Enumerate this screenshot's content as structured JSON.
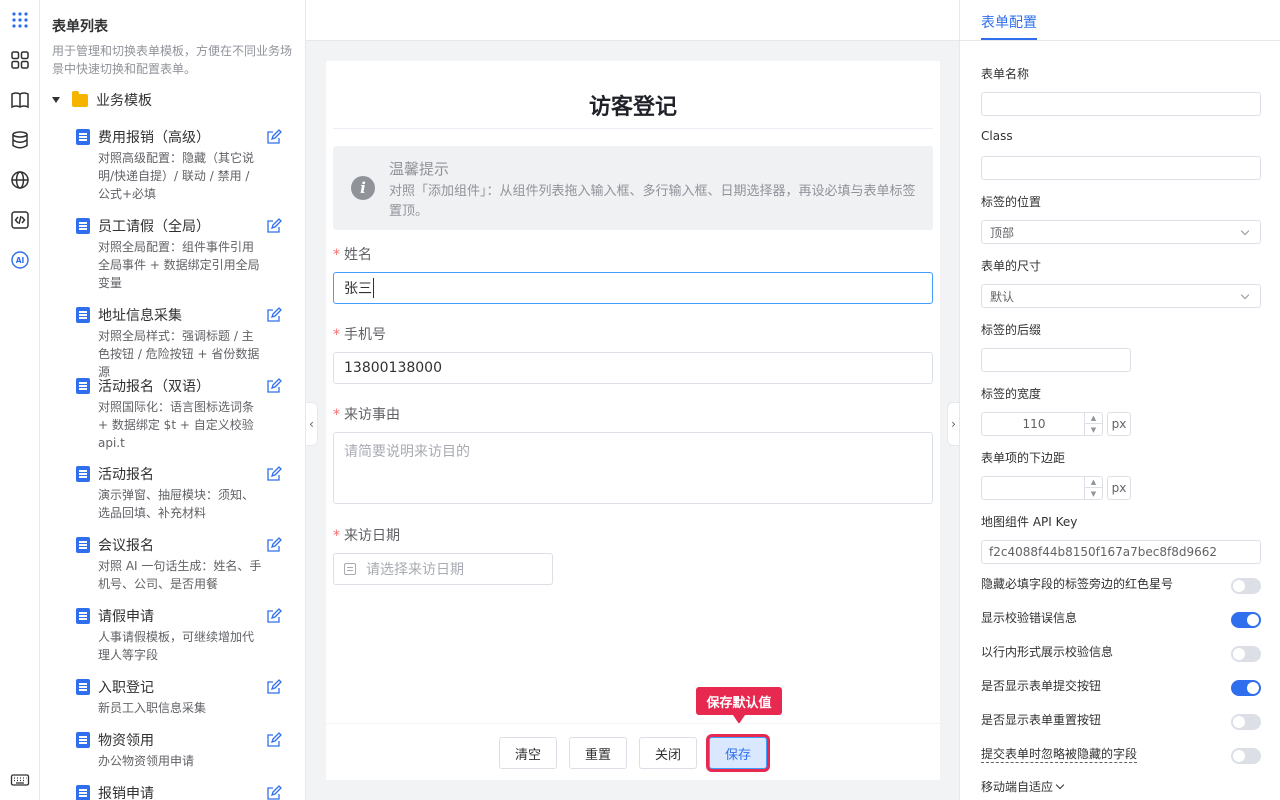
{
  "rail": {
    "icons": [
      "apps-grid-icon",
      "layout-icon",
      "book-icon",
      "database-icon",
      "globe-icon",
      "code-icon",
      "ai-icon",
      "keyboard-icon"
    ],
    "ai_label": "AI"
  },
  "list": {
    "title": "表单列表",
    "desc": "用于管理和切换表单模板，方便在不同业务场景中快速切换和配置表单。",
    "folder": "业务模板",
    "items": [
      {
        "name": "费用报销（高级）",
        "desc": "对照高级配置：隐藏（其它说明/快递自提）/ 联动 / 禁用 / 公式+必填"
      },
      {
        "name": "员工请假（全局）",
        "desc": "对照全局配置：组件事件引用全局事件 + 数据绑定引用全局变量"
      },
      {
        "name": "地址信息采集",
        "desc": "对照全局样式：强调标题 / 主色按钮 / 危险按钮 + 省份数据源"
      },
      {
        "name": "活动报名（双语）",
        "desc": "对照国际化：语言图标选词条 + 数据绑定 $t + 自定义校验 api.t"
      },
      {
        "name": "活动报名",
        "desc": "演示弹窗、抽屉模块：须知、选品回填、补充材料"
      },
      {
        "name": "会议报名",
        "desc": "对照 AI 一句话生成：姓名、手机号、公司、是否用餐"
      },
      {
        "name": "请假申请",
        "desc": "人事请假模板，可继续增加代理人等字段"
      },
      {
        "name": "入职登记",
        "desc": "新员工入职信息采集"
      },
      {
        "name": "物资领用",
        "desc": "办公物资领用申请"
      },
      {
        "name": "报销申请",
        "desc": ""
      }
    ]
  },
  "form": {
    "title": "访客登记",
    "tip_title": "温馨提示",
    "tip_content": "对照「添加组件」：从组件列表拖入输入框、多行输入框、日期选择器，再设必填与表单标签置顶。",
    "required_mark": "*",
    "name_label": "姓名",
    "name_value": "张三",
    "phone_label": "手机号",
    "phone_value": "13800138000",
    "reason_label": "来访事由",
    "reason_placeholder": "请简要说明来访目的",
    "date_label": "来访日期",
    "date_placeholder": "请选择来访日期"
  },
  "buttons": {
    "clear": "清空",
    "reset": "重置",
    "close": "关闭",
    "save": "保存",
    "save_tooltip": "保存默认值"
  },
  "config": {
    "tab": "表单配置",
    "form_name_label": "表单名称",
    "form_name_value": "",
    "class_label": "Class",
    "class_value": "",
    "label_position_label": "标签的位置",
    "label_position_value": "顶部",
    "form_size_label": "表单的尺寸",
    "form_size_value": "默认",
    "label_suffix_label": "标签的后缀",
    "label_suffix_value": "",
    "label_width_label": "标签的宽度",
    "label_width_value": "110",
    "unit": "px",
    "item_margin_label": "表单项的下边距",
    "item_margin_value": "",
    "map_key_label": "地图组件 API Key",
    "map_key_value": "f2c4088f44b8150f167a7bec8f8d9662",
    "toggles": [
      {
        "label": "隐藏必填字段的标签旁边的红色星号",
        "on": false
      },
      {
        "label": "显示校验错误信息",
        "on": true
      },
      {
        "label": "以行内形式展示校验信息",
        "on": false
      },
      {
        "label": "是否显示表单提交按钮",
        "on": true
      },
      {
        "label": "是否显示表单重置按钮",
        "on": false
      },
      {
        "label": "提交表单时忽略被隐藏的字段",
        "on": false
      }
    ],
    "mobile_label": "移动端自适应"
  },
  "colors": {
    "accent": "#2f6fed",
    "highlight": "#e8294f",
    "required": "#f56c6c"
  }
}
